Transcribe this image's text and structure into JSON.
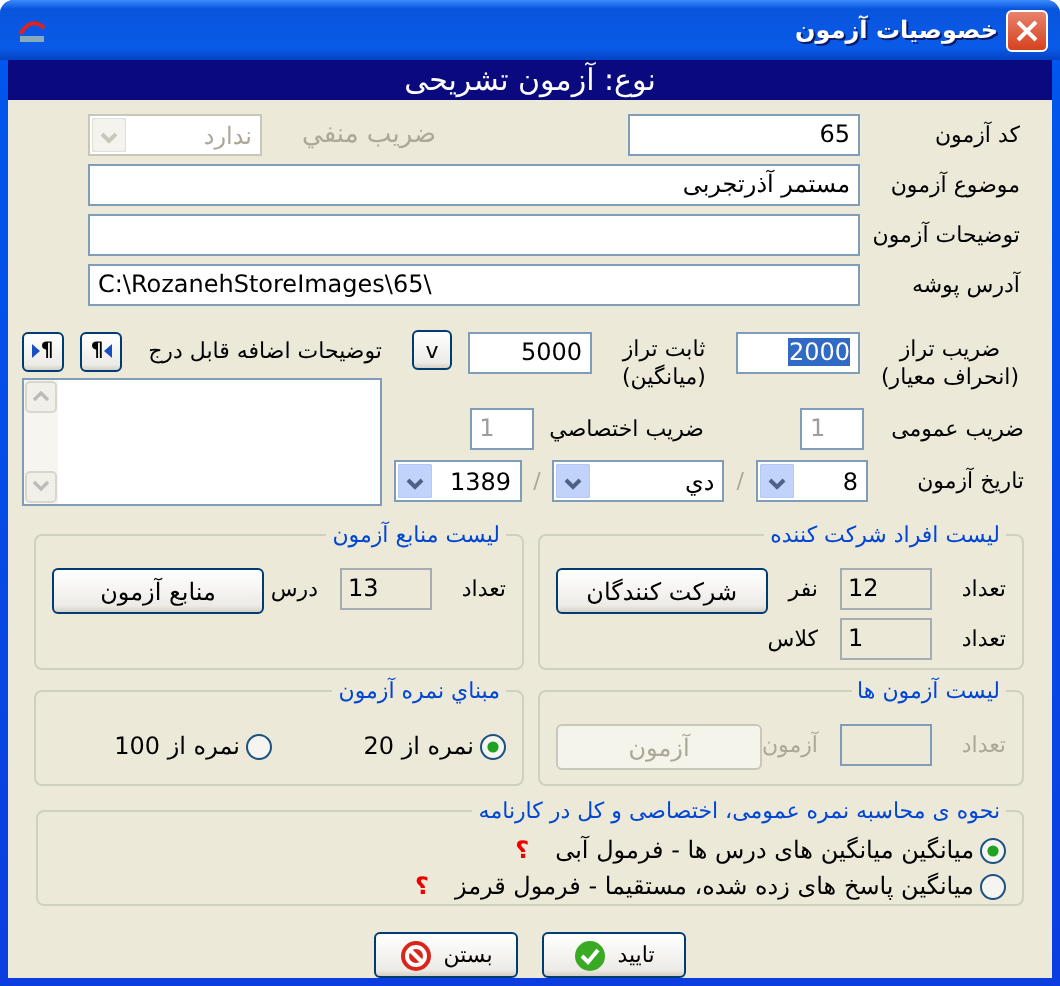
{
  "window": {
    "title": "خصوصیات آزمون"
  },
  "header": "نوع: آزمون تشریحی",
  "exam_code": {
    "label": "کد آزمون",
    "value": "65"
  },
  "negative_coefficient": {
    "label": "ضریب منفي",
    "value": "ندارد",
    "disabled": true
  },
  "subject": {
    "label": "موضوع آزمون",
    "value": "مستمر آذرتجربی"
  },
  "description": {
    "label": "توضیحات آزمون"
  },
  "folder": {
    "label": "آدرس پوشه",
    "value": "C:\\RozanehStoreImages\\65\\"
  },
  "scale_factor": {
    "label": "ضریب تراز (انحراف معیار)",
    "value": "2000",
    "text_selected": true
  },
  "scale_constant": {
    "label": "ثابت تراز (میانگین)",
    "value": "5000",
    "button": "v"
  },
  "general_coefficient": {
    "label": "ضریب عمومی",
    "value": "1",
    "disabled": true
  },
  "special_coefficient": {
    "label": "ضریب اختصاصي",
    "value": "1",
    "disabled": true
  },
  "exam_date": {
    "label": "تاریخ آزمون",
    "day": "8",
    "month": "دي",
    "year": "1389",
    "separators": [
      "/",
      "/"
    ]
  },
  "extra_notes": {
    "label": "توضیحات اضافه قابل درج",
    "buttons": [
      {
        "glyph": "¶",
        "kind": "rtl"
      },
      {
        "glyph": "¶",
        "kind": "ltr"
      }
    ]
  },
  "participants": {
    "title": "لیست افراد شرکت کننده",
    "disabled": false,
    "rows": [
      {
        "label": "تعداد",
        "value": "12",
        "unit": "نفر"
      },
      {
        "label": "تعداد",
        "value": "1",
        "unit": "کلاس"
      }
    ],
    "button": "شرکت کنندگان"
  },
  "sources": {
    "title": "لیست منابع آزمون",
    "disabled": false,
    "rows": [
      {
        "label": "تعداد",
        "value": "13",
        "unit": "درس"
      }
    ],
    "button": "منابع آزمون"
  },
  "exams": {
    "title": "لیست آزمون ها",
    "disabled": true,
    "rows": [
      {
        "label": "تعداد",
        "unit": "آزمون"
      }
    ],
    "button": "آزمون"
  },
  "grade_base": {
    "title": "مبناي نمره آزمون",
    "options": [
      {
        "label": "نمره از 20",
        "selected": true
      },
      {
        "label": "نمره از 100",
        "selected": false
      }
    ]
  },
  "calculation": {
    "title": "نحوه ی محاسبه نمره عمومی، اختصاصی و کل در کارنامه",
    "options": [
      {
        "label": "میانگین میانگین های درس ها - فرمول آبی",
        "help": "؟",
        "selected": true
      },
      {
        "label": "میانگین پاسخ های زده شده، مستقیما - فرمول قرمز",
        "help": "؟",
        "selected": false
      }
    ]
  },
  "buttons": [
    {
      "label": "تایید",
      "kind": "ok"
    },
    {
      "label": "بستن",
      "kind": "close"
    }
  ]
}
